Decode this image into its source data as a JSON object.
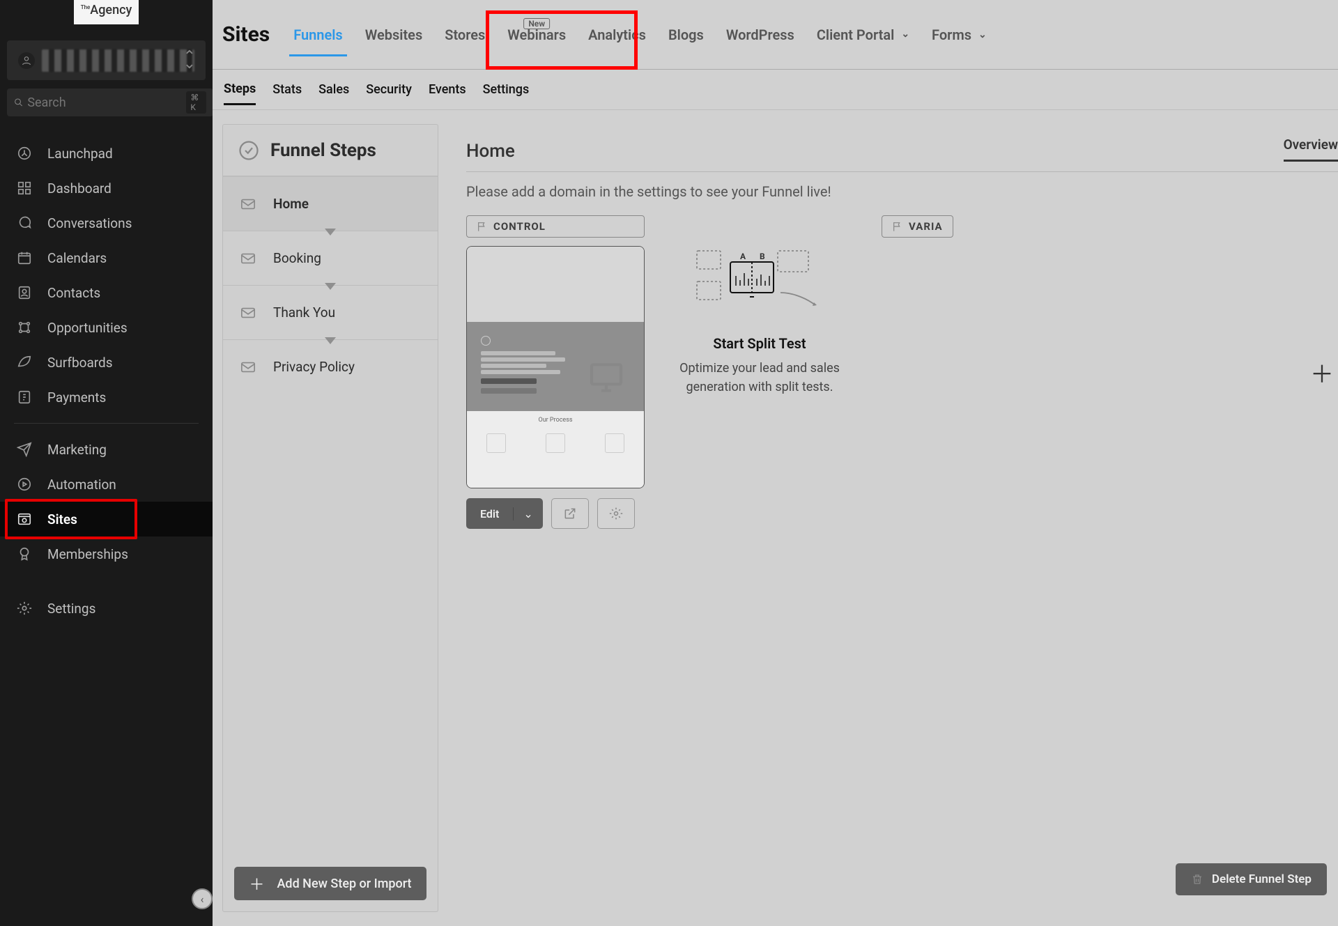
{
  "brand": {
    "logo_small": "The",
    "logo_main": "Agency"
  },
  "search": {
    "placeholder": "Search",
    "shortcut": "⌘ K"
  },
  "nav": {
    "group1": [
      "Launchpad",
      "Dashboard",
      "Conversations",
      "Calendars",
      "Contacts",
      "Opportunities",
      "Surfboards",
      "Payments"
    ],
    "group2": [
      "Marketing",
      "Automation",
      "Sites",
      "Memberships"
    ],
    "group3": [
      "Settings"
    ],
    "active": "Sites"
  },
  "topbar": {
    "title": "Sites",
    "tabs": [
      "Funnels",
      "Websites",
      "Stores",
      "Webinars",
      "Analytics",
      "Blogs",
      "WordPress",
      "Client Portal",
      "Forms"
    ],
    "active": "Funnels",
    "new_badge_on": "Webinars",
    "new_label": "New"
  },
  "subtabs": {
    "items": [
      "Steps",
      "Stats",
      "Sales",
      "Security",
      "Events",
      "Settings"
    ],
    "active": "Steps"
  },
  "steps": {
    "header": "Funnel Steps",
    "items": [
      "Home",
      "Booking",
      "Thank You",
      "Privacy Policy"
    ],
    "add_label": "Add New Step or Import"
  },
  "detail": {
    "title": "Home",
    "tab": "Overview",
    "warning": "Please add a domain in the settings to see your Funnel live!",
    "control_label": "CONTROL",
    "variation_label": "VARIA",
    "edit": "Edit",
    "preview_process": "Our Process",
    "split": {
      "title": "Start Split Test",
      "desc": "Optimize your lead and sales generation with split tests."
    },
    "delete": "Delete Funnel Step"
  }
}
